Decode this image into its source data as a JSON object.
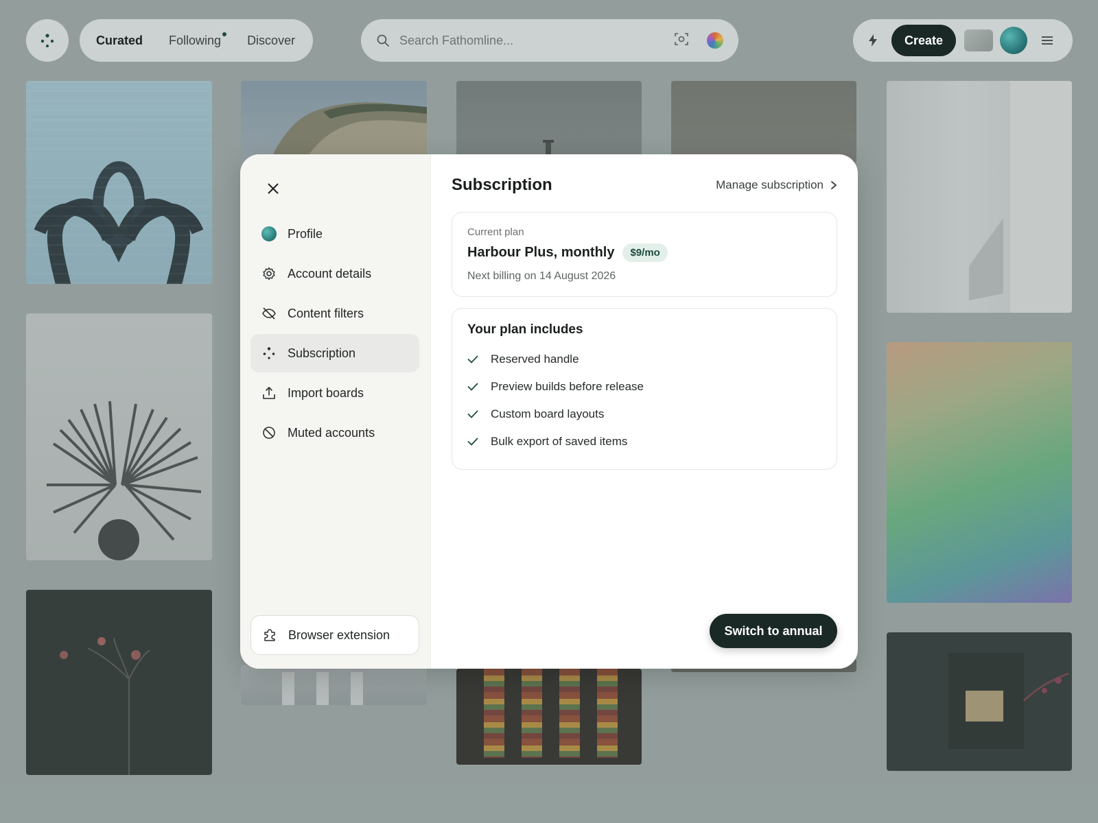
{
  "topbar": {
    "tabs": [
      {
        "label": "Curated",
        "active": true
      },
      {
        "label": "Following",
        "has_dot": true
      },
      {
        "label": "Discover"
      }
    ],
    "search": {
      "placeholder": "Search Fathomline..."
    },
    "create_label": "Create"
  },
  "modal": {
    "nav": [
      {
        "label": "Profile",
        "icon": "avatar"
      },
      {
        "label": "Account details",
        "icon": "gear-icon"
      },
      {
        "label": "Content filters",
        "icon": "eye-off-icon"
      },
      {
        "label": "Subscription",
        "icon": "sparkle-dots-icon",
        "active": true
      },
      {
        "label": "Import boards",
        "icon": "upload-icon"
      },
      {
        "label": "Muted accounts",
        "icon": "block-icon"
      }
    ],
    "extension_label": "Browser extension",
    "title": "Subscription",
    "manage_label": "Manage subscription",
    "plan": {
      "label": "Current plan",
      "name": "Harbour Plus, monthly",
      "price": "$9/mo",
      "next_billing": "Next billing on 14 August 2026"
    },
    "includes": {
      "title": "Your plan includes",
      "features": [
        "Reserved handle",
        "Preview builds before release",
        "Custom board layouts",
        "Bulk export of saved items"
      ]
    },
    "cta_label": "Switch to annual"
  },
  "colors": {
    "accent_dark": "#1a2826",
    "price_badge_bg": "#e3efe9",
    "check_color": "#1f4a3f"
  }
}
